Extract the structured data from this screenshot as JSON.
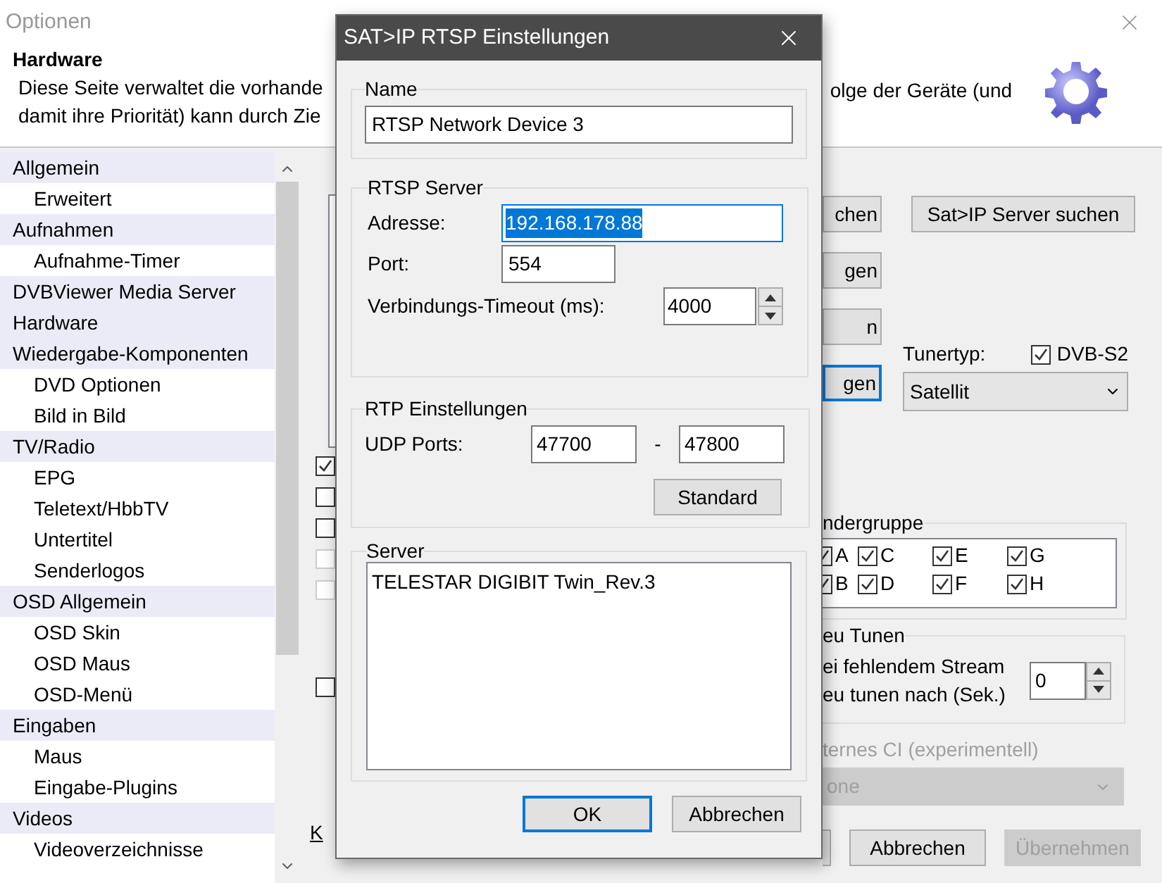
{
  "window": {
    "title": "Optionen"
  },
  "header": {
    "title": "Hardware",
    "description_left": [
      "Diese Seite verwaltet die vorhande",
      "damit ihre Priorität) kann durch Zie"
    ],
    "description_right": "olge der Geräte (und"
  },
  "sidebar": {
    "items": [
      {
        "label": "Allgemein",
        "children": [
          {
            "label": "Erweitert"
          }
        ]
      },
      {
        "label": "Aufnahmen",
        "children": [
          {
            "label": "Aufnahme-Timer"
          }
        ]
      },
      {
        "label": "DVBViewer Media Server"
      },
      {
        "label": "Hardware"
      },
      {
        "label": "Wiedergabe-Komponenten",
        "children": [
          {
            "label": "DVD Optionen"
          },
          {
            "label": "Bild in Bild"
          }
        ]
      },
      {
        "label": "TV/Radio",
        "children": [
          {
            "label": "EPG"
          },
          {
            "label": "Teletext/HbbTV"
          },
          {
            "label": "Untertitel"
          },
          {
            "label": "Senderlogos"
          }
        ]
      },
      {
        "label": "OSD Allgemein",
        "children": [
          {
            "label": "OSD Skin"
          },
          {
            "label": "OSD Maus"
          },
          {
            "label": "OSD-Menü"
          }
        ]
      },
      {
        "label": "Eingaben",
        "children": [
          {
            "label": "Maus"
          },
          {
            "label": "Eingabe-Plugins"
          }
        ]
      },
      {
        "label": "Videos",
        "children": [
          {
            "label": "Videoverzeichnisse"
          }
        ]
      }
    ]
  },
  "left_fragments": {
    "checkboxes": [
      {
        "checked": true,
        "disabled": false
      },
      {
        "checked": false,
        "disabled": false
      },
      {
        "checked": false,
        "disabled": false
      },
      {
        "checked": false,
        "disabled": true
      },
      {
        "checked": false,
        "disabled": true
      }
    ],
    "checkbox_bottom": {
      "checked": false
    },
    "link": "K"
  },
  "right_panel": {
    "buttons": [
      {
        "label": "chen",
        "focused": false
      },
      {
        "label": "gen",
        "focused": false
      },
      {
        "label": "n",
        "focused": false
      },
      {
        "label": "gen",
        "focused": true
      }
    ],
    "search_button": "Sat>IP Server suchen",
    "tuner_type": {
      "label": "Tunertyp:",
      "value": "Satellit"
    },
    "dvb_s2": {
      "label": "DVB-S2",
      "checked": true
    },
    "channel_groups": {
      "title": "ndergruppe",
      "items": [
        {
          "label": "A",
          "checked": true
        },
        {
          "label": "B",
          "checked": true
        },
        {
          "label": "C",
          "checked": true
        },
        {
          "label": "D",
          "checked": true
        },
        {
          "label": "E",
          "checked": true
        },
        {
          "label": "F",
          "checked": true
        },
        {
          "label": "G",
          "checked": true
        },
        {
          "label": "H",
          "checked": true
        }
      ]
    },
    "retune": {
      "title": "eu Tunen",
      "lines": [
        "ei fehlendem Stream",
        "eu tunen nach (Sek.)"
      ],
      "value": "0"
    },
    "ci": {
      "label": "ternes CI (experimentell)",
      "value": "one",
      "disabled": true
    },
    "footer_buttons": [
      {
        "label": "Abbrechen",
        "disabled": false
      },
      {
        "label": "Übernehmen",
        "disabled": true
      }
    ]
  },
  "dialog": {
    "title": "SAT>IP RTSP Einstellungen",
    "name_group": {
      "title": "Name",
      "value": "RTSP Network Device 3"
    },
    "rtsp": {
      "title": "RTSP Server",
      "address": {
        "label": "Adresse:",
        "value": "192.168.178.88",
        "selected": true
      },
      "port": {
        "label": "Port:",
        "value": "554"
      },
      "timeout": {
        "label": "Verbindungs-Timeout (ms):",
        "value": "4000"
      }
    },
    "rtp": {
      "title": "RTP Einstellungen",
      "label": "UDP Ports:",
      "from": "47700",
      "separator": "-",
      "to": "47800",
      "button": "Standard"
    },
    "server": {
      "title": "Server",
      "items": [
        "TELESTAR DIGIBIT Twin_Rev.3"
      ]
    },
    "buttons": [
      {
        "label": "OK",
        "default": true
      },
      {
        "label": "Abbrechen",
        "default": false
      }
    ]
  }
}
